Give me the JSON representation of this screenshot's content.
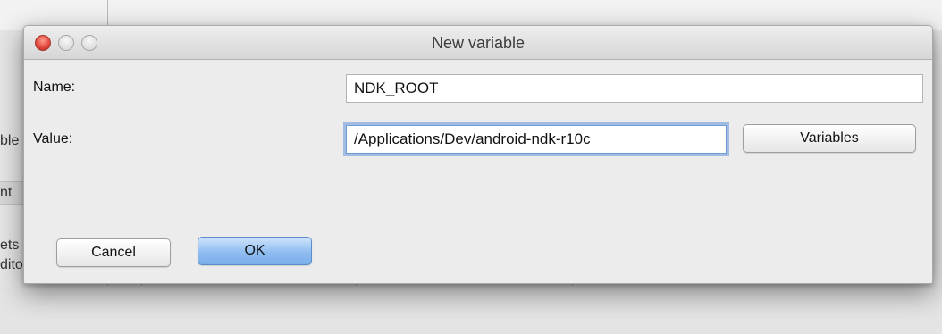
{
  "background": {
    "fragments": [
      "ble",
      "nt",
      "ets",
      "dito"
    ]
  },
  "dialog": {
    "title": "New variable",
    "name_label": "Name:",
    "name_value": "NDK_ROOT",
    "value_label": "Value:",
    "value_value": "/Applications/Dev/android-ndk-r10c",
    "variables_button": "Variables",
    "cancel_button": "Cancel",
    "ok_button": "OK"
  },
  "colors": {
    "close": "#e0443a",
    "primary_button": "#8fbdf1",
    "focus_ring": "#6c9fd6"
  }
}
